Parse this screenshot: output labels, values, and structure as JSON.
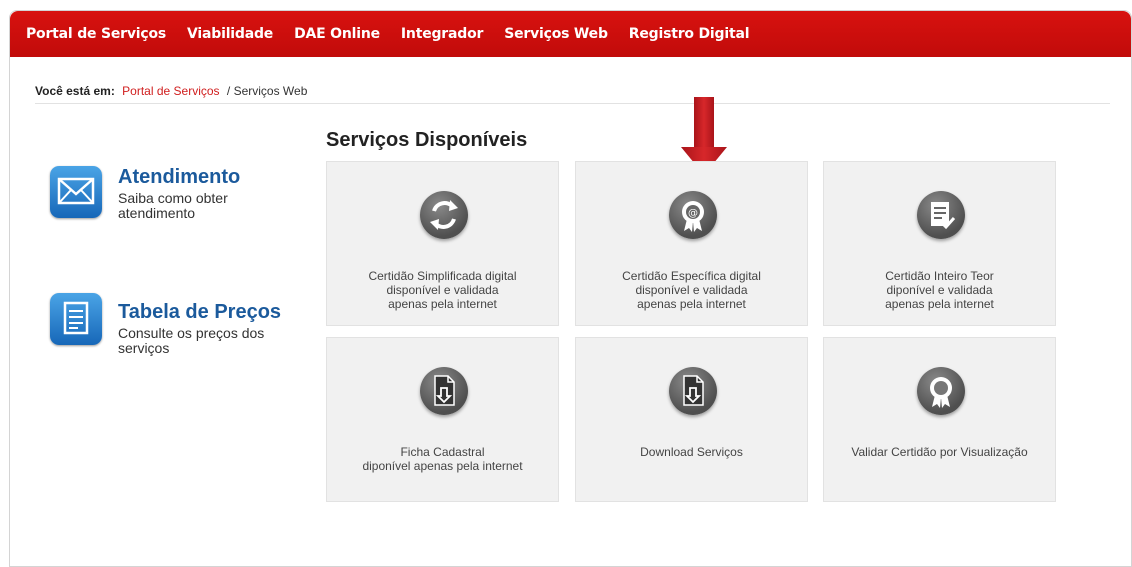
{
  "nav": {
    "items": [
      "Portal de Serviços",
      "Viabilidade",
      "DAE Online",
      "Integrador",
      "Serviços Web",
      "Registro Digital"
    ]
  },
  "breadcrumb": {
    "label": "Você está em:",
    "link": "Portal de Serviços",
    "current": "/ Serviços Web"
  },
  "sidebar": {
    "atendimento": {
      "title": "Atendimento",
      "desc": "Saiba como obter atendimento",
      "icon": "mail-icon"
    },
    "precos": {
      "title": "Tabela de Preços",
      "desc": "Consulte os preços dos serviços",
      "icon": "document-icon"
    }
  },
  "main": {
    "heading": "Serviços Disponíveis",
    "cards": [
      {
        "line1": "Certidão Simplificada digital",
        "line2": "disponível e validada",
        "line3": "apenas pela internet",
        "icon": "refresh-icon"
      },
      {
        "line1": "Certidão Específica digital",
        "line2": "disponível e validada",
        "line3": "apenas pela internet",
        "icon": "certificate-seal-icon"
      },
      {
        "line1": "Certidão Inteiro Teor",
        "line2": "diponível e validada",
        "line3": "apenas pela internet",
        "icon": "document-check-icon"
      },
      {
        "line1": "Ficha Cadastral",
        "line2": "diponível apenas pela internet",
        "icon": "file-download-icon"
      },
      {
        "line1": "Download Serviços",
        "icon": "file-download-icon"
      },
      {
        "line1": "Validar Certidão por Visualização",
        "icon": "award-ribbon-icon"
      }
    ]
  },
  "colors": {
    "nav_red": "#c70e0c",
    "link_red": "#d01d1d",
    "blue_title": "#1b5a9c",
    "arrow_red": "#c51f1f"
  }
}
